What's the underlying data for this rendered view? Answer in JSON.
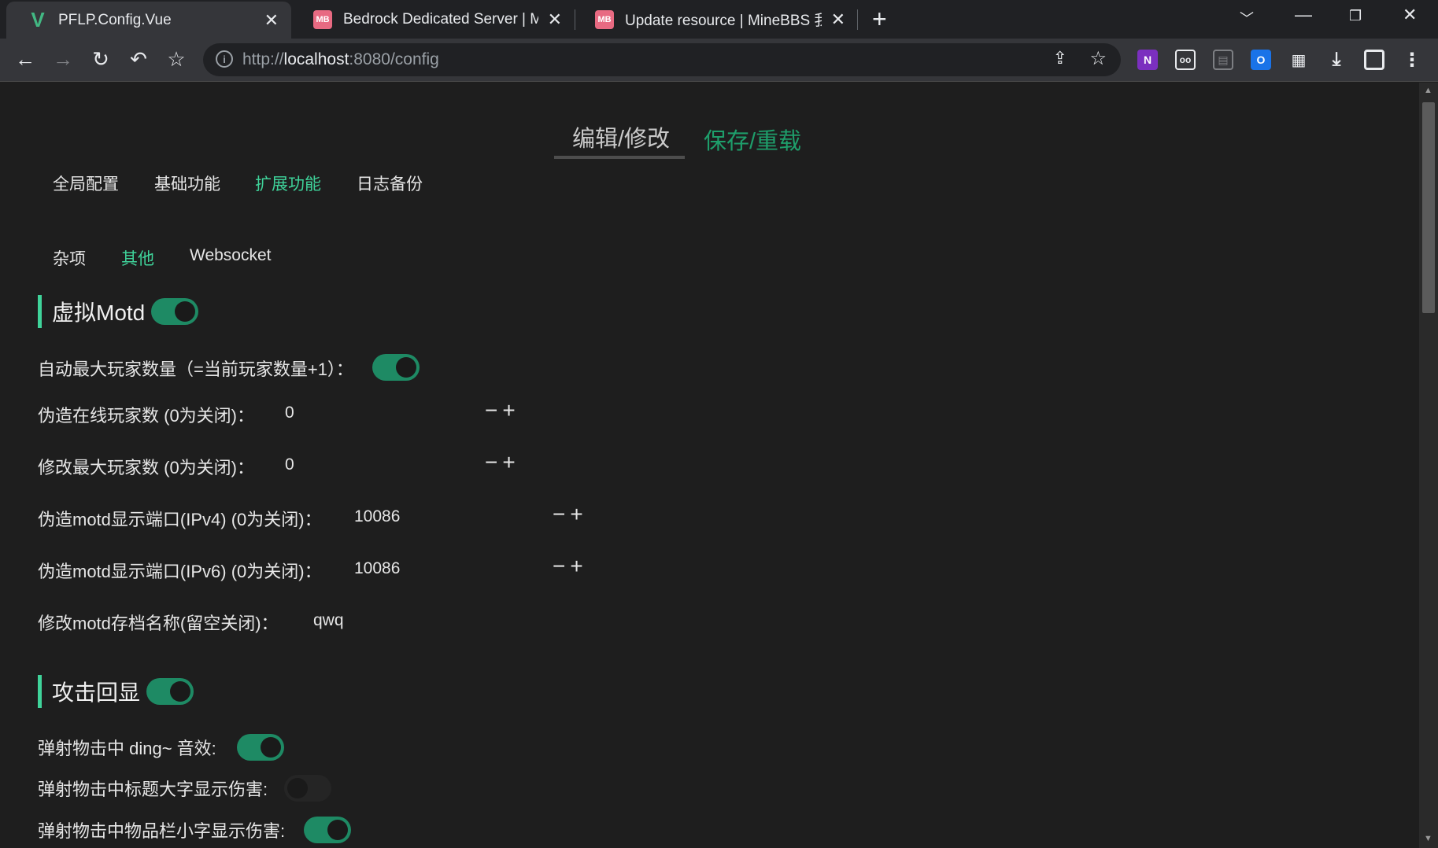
{
  "browser": {
    "tabs": [
      {
        "title": "PFLP.Config.Vue",
        "favicon": "V",
        "active": true
      },
      {
        "title": "Bedrock Dedicated Server | MineBBS",
        "favicon": "MB",
        "active": false
      },
      {
        "title": "Update resource | MineBBS 我的世界",
        "favicon": "MB",
        "active": false
      }
    ],
    "new_tab": "+",
    "url_prefix": "http://",
    "url_host": "localhost",
    "url_path": ":8080/config"
  },
  "top_tabs": {
    "edit": "编辑/修改",
    "save": "保存/重载"
  },
  "nav1": [
    "全局配置",
    "基础功能",
    "扩展功能",
    "日志备份"
  ],
  "nav1_active": 2,
  "nav2": [
    "杂项",
    "其他",
    "Websocket"
  ],
  "nav2_active": 1,
  "motd": {
    "title": "虚拟Motd",
    "enabled": true,
    "auto_max_label": "自动最大玩家数量（=当前玩家数量+1）：",
    "auto_max_enabled": true,
    "fake_online_label": "伪造在线玩家数 (0为关闭)：",
    "fake_online_value": "0",
    "max_players_label": "修改最大玩家数 (0为关闭)：",
    "max_players_value": "0",
    "port_v4_label": "伪造motd显示端口(IPv4) (0为关闭)：",
    "port_v4_value": "10086",
    "port_v6_label": "伪造motd显示端口(IPv6) (0为关闭)：",
    "port_v6_value": "10086",
    "level_name_label": "修改motd存档名称(留空关闭)：",
    "level_name_value": "qwq",
    "minus": "−",
    "plus": "+"
  },
  "attack": {
    "title": "攻击回显",
    "enabled": true,
    "ding_label": "弹射物击中 ding~ 音效:",
    "ding_enabled": true,
    "title_label": "弹射物击中标题大字显示伤害:",
    "title_enabled": false,
    "actionbar_label": "弹射物击中物品栏小字显示伤害:",
    "actionbar_enabled": true
  }
}
